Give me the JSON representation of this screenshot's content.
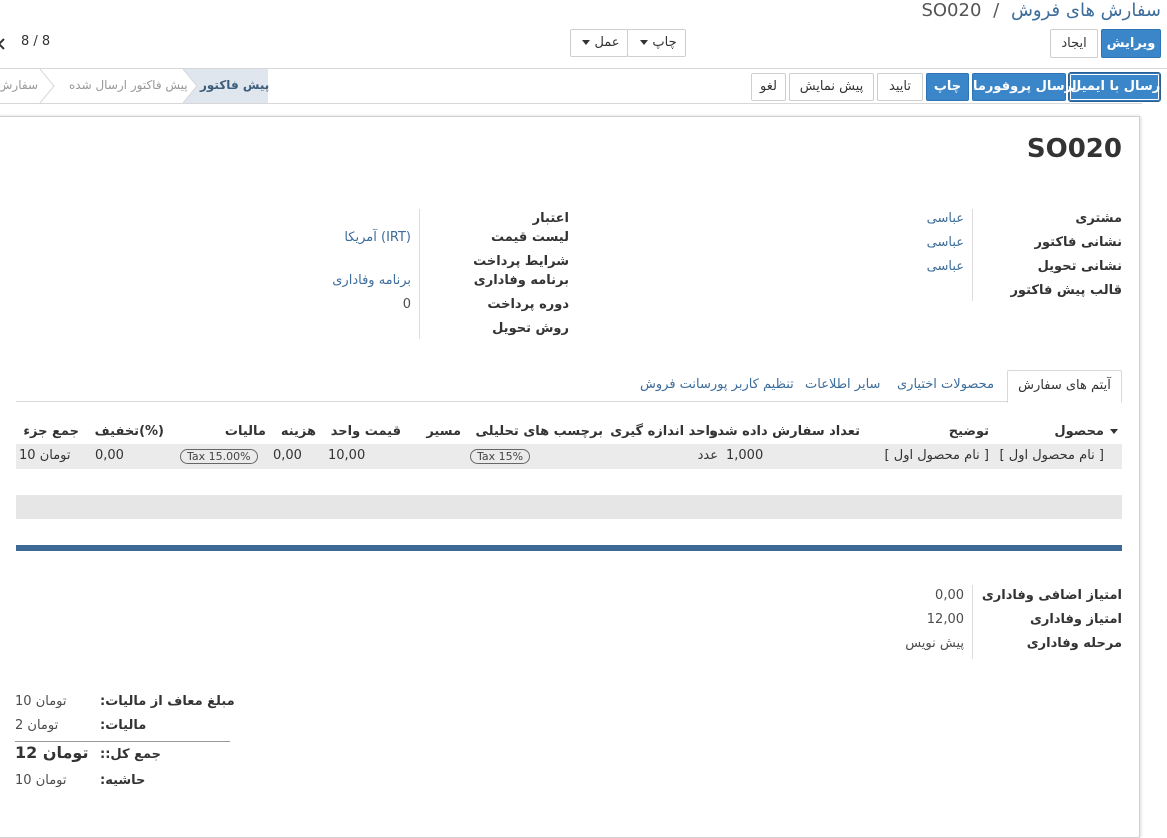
{
  "breadcrumb": {
    "parent": "سفارش های فروش",
    "separator": "/",
    "current": "SO020"
  },
  "toolbar": {
    "edit": "ویرایش",
    "create": "ایجاد",
    "print": "چاپ",
    "action": "عمل"
  },
  "pager": {
    "text": "8 / 8"
  },
  "actions": {
    "send_email": "ارسال با ایمیل",
    "send_proforma": "ارسال پروفورما",
    "print": "چاپ",
    "confirm": "تایید",
    "preview": "پیش نمایش",
    "cancel": "لغو"
  },
  "statusbar": {
    "current": "پیش فاکتور",
    "sent": "پیش فاکتور ارسال شده",
    "sale": "سفارش ف"
  },
  "record": {
    "name": "SO020"
  },
  "left_group": {
    "labels": {
      "customer": "مشتری",
      "invoice_address": "نشانی فاکتور",
      "delivery_address": "نشانی تحویل",
      "template": "قالب پیش فاکتور"
    },
    "values": {
      "customer": "عباسی",
      "invoice_address": "عباسی",
      "delivery_address": "عباسی"
    }
  },
  "right_group": {
    "labels": {
      "validity": "اعتبار",
      "pricelist": "لیست قیمت",
      "payment_terms": "شرایط پرداخت",
      "loyalty": "برنامه وفاداری",
      "payment_period": "دوره پرداخت",
      "delivery_method": "روش تحویل"
    },
    "values": {
      "pricelist": "آمریکا (IRT)",
      "loyalty": "برنامه وفاداری",
      "payment_period": "0"
    }
  },
  "tabs": [
    "آیتم های سفارش",
    "محصولات اختیاری",
    "سایر اطلاعات",
    "تنظیم کاربر پورسانت فروش"
  ],
  "table": {
    "headers": {
      "product": "محصول",
      "description": "توضیح",
      "qty": "تعداد سفارش داده شده",
      "uom": "واحد اندازه گیری",
      "analytic_tags": "برچسب های تحلیلی",
      "route": "مسیر",
      "unit_price": "قیمت واحد",
      "cost": "هزینه",
      "taxes": "مالیات",
      "discount": "تخفیف(%)",
      "subtotal": "جمع جزء"
    },
    "row": {
      "product": "[ نام محصول اول ]",
      "description": "[ نام محصول اول ]",
      "qty": "1,000",
      "uom": "عدد",
      "analytic_tag": "Tax 15%",
      "unit_price": "10,00",
      "cost": "0,00",
      "tax": "Tax 15.00%",
      "discount": "0,00",
      "subtotal": "10 تومان"
    }
  },
  "loyalty_info": {
    "labels": {
      "extra_points": "امتیاز اضافی وفاداری",
      "points": "امتیاز وفاداری",
      "level": "مرحله وفاداری"
    },
    "values": {
      "extra_points": "0,00",
      "points": "12,00",
      "level": "پیش نویس"
    }
  },
  "totals": {
    "untaxed_label": "مبلغ معاف از مالیات:",
    "untaxed": "10 تومان",
    "tax_label": "مالیات:",
    "tax": "2 تومان",
    "total_label": "جمع کل::",
    "total": "12 تومان",
    "margin_label": "حاشیه:",
    "margin": "10 تومان"
  },
  "colors": {
    "primary": "#3b86c9",
    "link": "#3d6d9b",
    "section_bar": "#3d6a94",
    "statusbar_active": "#dfe6ee"
  }
}
